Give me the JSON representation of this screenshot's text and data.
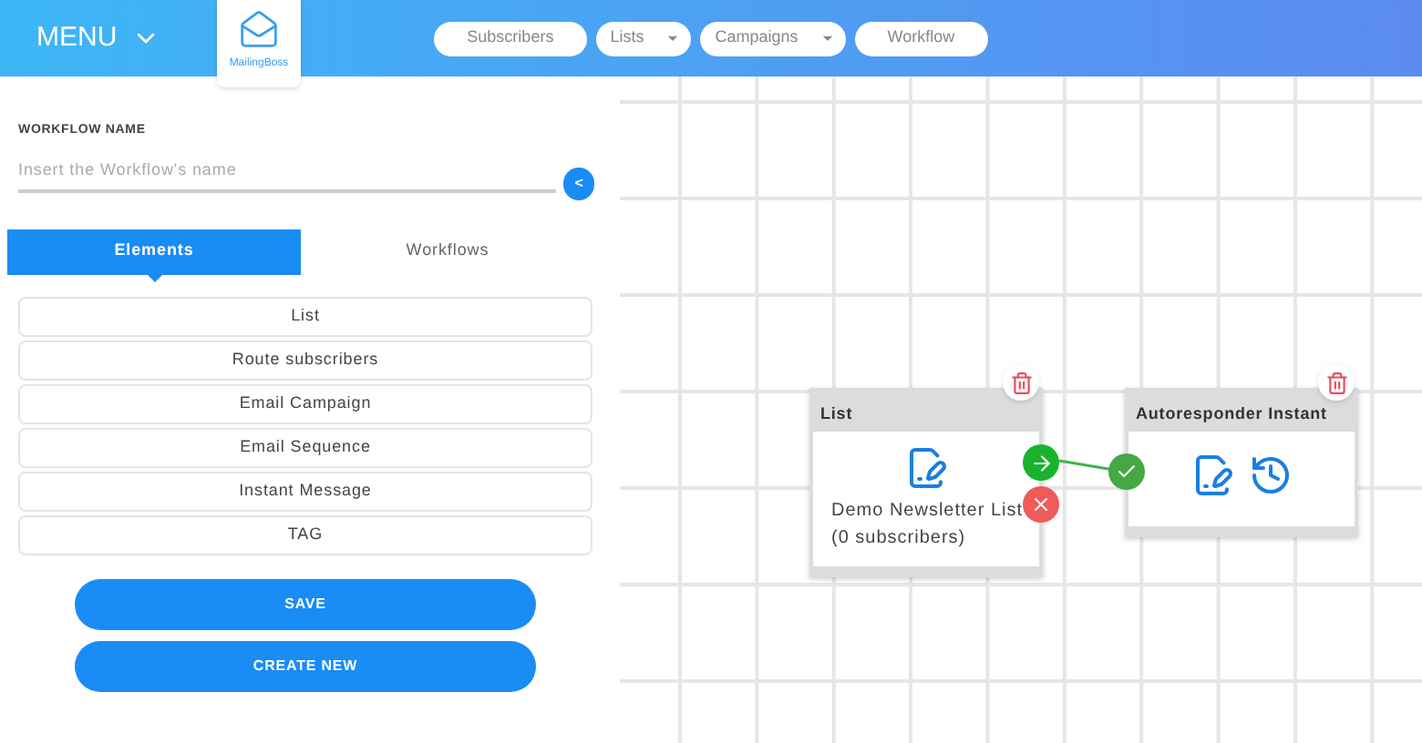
{
  "header": {
    "menu": "MENU",
    "logo": "MailingBoss",
    "nav": [
      {
        "label": "Subscribers",
        "kind": "link"
      },
      {
        "label": "Lists",
        "kind": "dropdown"
      },
      {
        "label": "Campaigns",
        "kind": "dropdown"
      },
      {
        "label": "Workflow",
        "kind": "link"
      }
    ]
  },
  "workflow_name": {
    "label": "WORKFLOW NAME",
    "placeholder": "Insert the Workflow's name",
    "toggle": "<"
  },
  "tabs": [
    {
      "label": "Elements",
      "selected": true
    },
    {
      "label": "Workflows",
      "selected": false
    }
  ],
  "elements": [
    "List",
    "Route subscribers",
    "Email Campaign",
    "Email Sequence",
    "Instant Message",
    "TAG"
  ],
  "buttons": [
    "SAVE",
    "CREATE NEW"
  ],
  "canvas": {
    "nodes": [
      {
        "title": "List",
        "kind": "list",
        "text": "Demo Newsletter List",
        "subtext": "(0 subscribers)"
      },
      {
        "title": "Autoresponder Instant",
        "kind": "autoresponder"
      }
    ]
  }
}
